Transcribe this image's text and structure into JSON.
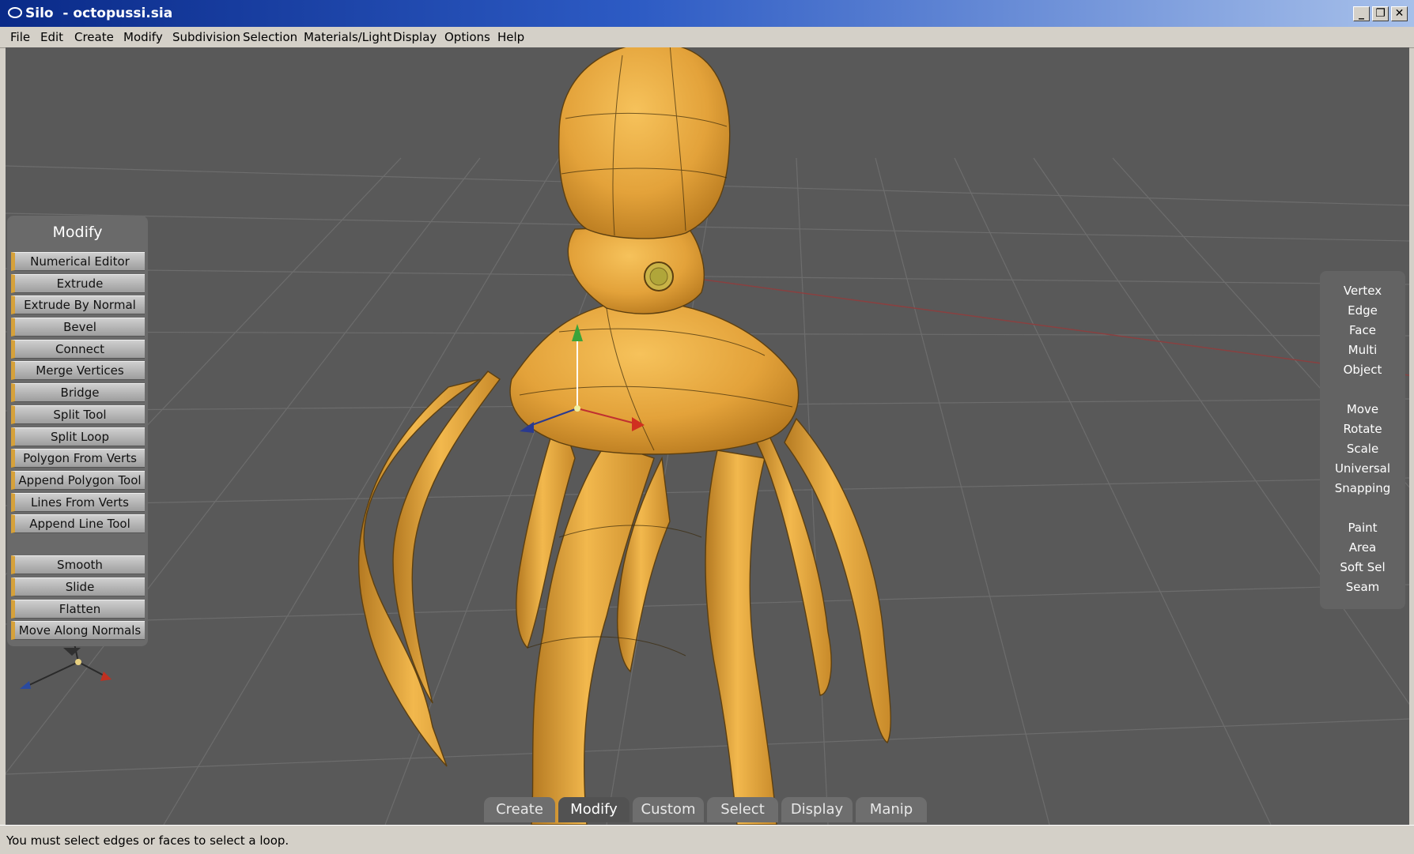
{
  "window": {
    "title": "Silo  - octopussi.sia"
  },
  "menu": [
    "File",
    "Edit",
    "Create",
    "Modify",
    "Subdivision",
    "Selection",
    "Materials/Light",
    "Display",
    "Options",
    "Help"
  ],
  "modify_panel": {
    "title": "Modify",
    "group1": [
      "Numerical Editor",
      "Extrude",
      "Extrude By Normal",
      "Bevel",
      "Connect",
      "Merge Vertices",
      "Bridge",
      "Split Tool",
      "Split Loop",
      "Polygon From Verts",
      "Append Polygon Tool",
      "Lines From Verts",
      "Append Line Tool"
    ],
    "group2": [
      "Smooth",
      "Slide",
      "Flatten",
      "Move Along Normals"
    ]
  },
  "selection_panel": {
    "modes": [
      "Vertex",
      "Edge",
      "Face",
      "Multi",
      "Object"
    ],
    "manipulators": [
      "Move",
      "Rotate",
      "Scale",
      "Universal",
      "Snapping"
    ],
    "selection_tools": [
      "Paint",
      "Area",
      "Soft Sel",
      "Seam"
    ]
  },
  "tabs": [
    "Create",
    "Modify",
    "Custom",
    "Select",
    "Display",
    "Manip"
  ],
  "active_tab": "Modify",
  "status": "You must select edges or faces to select a loop.",
  "colors": {
    "viewport_bg": "#595959",
    "model": "#e8a53a",
    "title_bar": "#0a2a88"
  },
  "icons": [
    "app-icon",
    "minimize-icon",
    "restore-icon",
    "close-icon",
    "expand-arrow-icon",
    "axis-gizmo-icon",
    "manipulator-icon"
  ]
}
